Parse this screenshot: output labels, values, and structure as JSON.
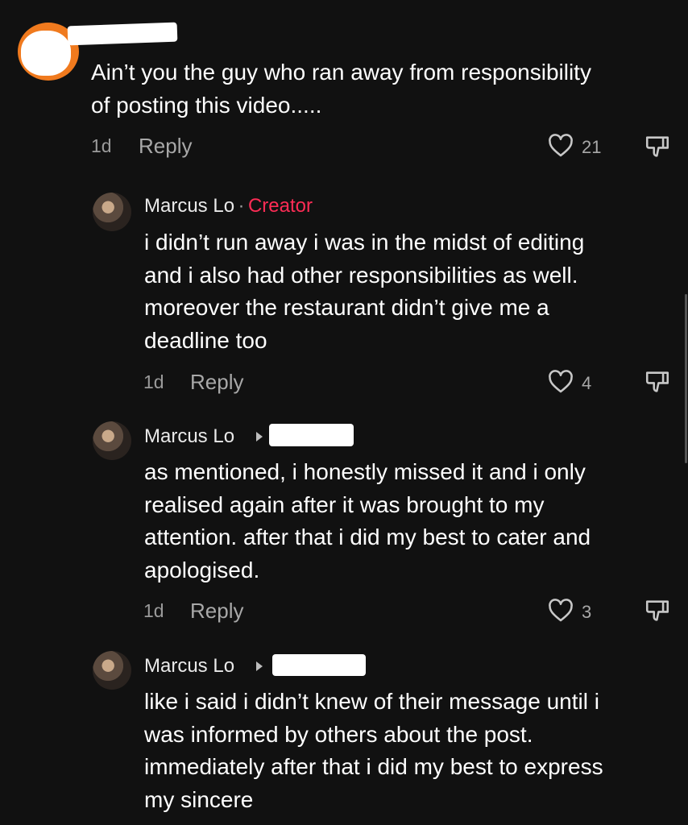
{
  "colors": {
    "background": "#111111",
    "creator_badge": "#fe2c55",
    "secondary_text": "#a8a8a8"
  },
  "icons": {
    "like": "heart-outline-icon",
    "dislike": "thumbs-down-icon",
    "reply_arrow": "triangle-right-icon"
  },
  "top_comment": {
    "text": "Ain’t you the guy who ran away from responsibility\nof posting this video.....",
    "time": "1d",
    "reply_label": "Reply",
    "likes": "21"
  },
  "replies": [
    {
      "author": "Marcus Lo",
      "separator": "·",
      "badge": "Creator",
      "text": "i didn’t run away i was in the midst of editing\nand i also had other responsibilities as well.\nmoreover the restaurant didn’t give me a\ndeadline too",
      "time": "1d",
      "reply_label": "Reply",
      "likes": "4"
    },
    {
      "author": "Marcus Lo",
      "text": "as mentioned, i honestly missed it and i only\nrealised again after it was brought to my\nattention. after that i did my best to cater and\napologised.",
      "time": "1d",
      "reply_label": "Reply",
      "likes": "3"
    },
    {
      "author": "Marcus Lo",
      "text": "like i said i didn’t knew of their message until i\nwas informed by others about the post.\nimmediately after that i did my best to express\nmy sincere"
    }
  ]
}
